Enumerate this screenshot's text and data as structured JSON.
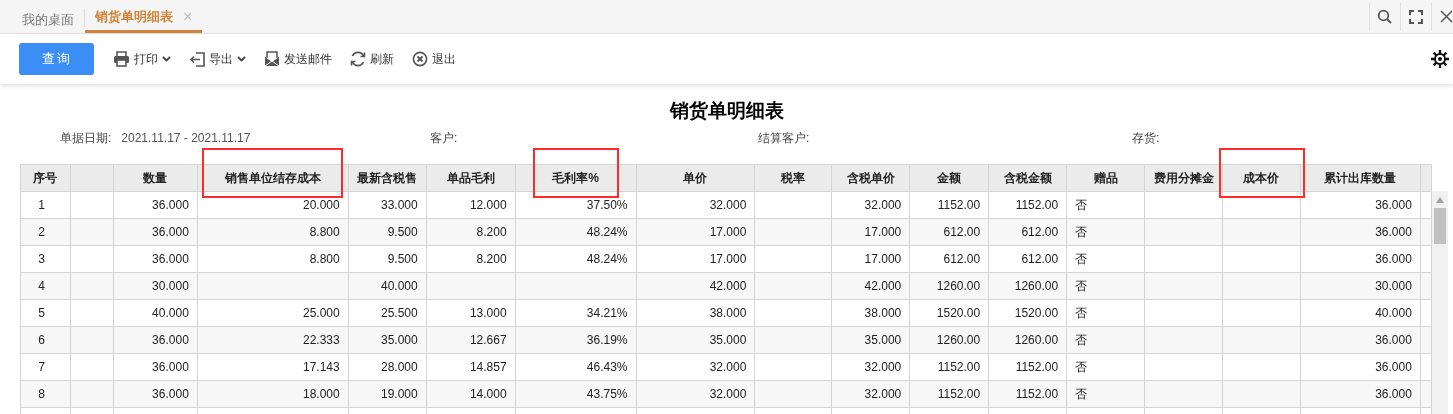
{
  "tabs": [
    {
      "label": "我的桌面",
      "selected": false
    },
    {
      "label": "销货单明细表",
      "selected": true,
      "close": "×"
    }
  ],
  "toolbar": {
    "query_button": "查询",
    "items": [
      {
        "label": "打印",
        "dropdown": true
      },
      {
        "label": "导出",
        "dropdown": true
      },
      {
        "label": "发送邮件",
        "dropdown": false
      },
      {
        "label": "刷新",
        "dropdown": false
      },
      {
        "label": "退出",
        "dropdown": false
      }
    ]
  },
  "report": {
    "title": "销货单明细表",
    "filters": [
      {
        "label": "单据日期:",
        "value": "2021.11.17 - 2021.11.17"
      },
      {
        "label": "客户:"
      },
      {
        "label": "结算客户:"
      },
      {
        "label": "存货:"
      }
    ],
    "table": {
      "columns": [
        {
          "label": "序号",
          "kind": "index",
          "highlighted": false
        },
        {
          "kind": "number",
          "highlighted": false
        },
        {
          "label": "数量",
          "kind": "number",
          "highlighted": false
        },
        {
          "label": "销售单位结存成本",
          "kind": "number",
          "highlighted": true
        },
        {
          "label": "最新含税售",
          "kind": "number",
          "highlighted": false
        },
        {
          "label": "单品毛利",
          "kind": "number",
          "highlighted": false
        },
        {
          "label": "毛利率%",
          "kind": "number",
          "highlighted": true
        },
        {
          "label": "单价",
          "kind": "number",
          "highlighted": false
        },
        {
          "label": "税率",
          "kind": "number",
          "highlighted": false
        },
        {
          "label": "含税单价",
          "kind": "number",
          "highlighted": false
        },
        {
          "label": "金额",
          "kind": "number",
          "highlighted": false
        },
        {
          "label": "含税金额",
          "kind": "number",
          "highlighted": false
        },
        {
          "label": "赠品",
          "kind": "text",
          "highlighted": false
        },
        {
          "label": "费用分摊金",
          "kind": "number",
          "highlighted": false
        },
        {
          "label": "成本价",
          "kind": "number",
          "highlighted": true
        },
        {
          "label": "累计出库数量",
          "kind": "number",
          "highlighted": false
        }
      ],
      "rows": [
        [
          "1",
          null,
          "36.000",
          "20.000",
          "33.000",
          "12.000",
          "37.50%",
          "32.000",
          null,
          "32.000",
          "1152.00",
          "1152.00",
          "否",
          null,
          null,
          "36.000"
        ],
        [
          "2",
          null,
          "36.000",
          "8.800",
          "9.500",
          "8.200",
          "48.24%",
          "17.000",
          null,
          "17.000",
          "612.00",
          "612.00",
          "否",
          null,
          null,
          "36.000"
        ],
        [
          "3",
          null,
          "36.000",
          "8.800",
          "9.500",
          "8.200",
          "48.24%",
          "17.000",
          null,
          "17.000",
          "612.00",
          "612.00",
          "否",
          null,
          null,
          "36.000"
        ],
        [
          "4",
          null,
          "30.000",
          null,
          "40.000",
          null,
          null,
          "42.000",
          null,
          "42.000",
          "1260.00",
          "1260.00",
          "否",
          null,
          null,
          "30.000"
        ],
        [
          "5",
          null,
          "40.000",
          "25.000",
          "25.500",
          "13.000",
          "34.21%",
          "38.000",
          null,
          "38.000",
          "1520.00",
          "1520.00",
          "否",
          null,
          null,
          "40.000"
        ],
        [
          "6",
          null,
          "36.000",
          "22.333",
          "35.000",
          "12.667",
          "36.19%",
          "35.000",
          null,
          "35.000",
          "1260.00",
          "1260.00",
          "否",
          null,
          null,
          "36.000"
        ],
        [
          "7",
          null,
          "36.000",
          "17.143",
          "28.000",
          "14.857",
          "46.43%",
          "32.000",
          null,
          "32.000",
          "1152.00",
          "1152.00",
          "否",
          null,
          null,
          "36.000"
        ],
        [
          "8",
          null,
          "36.000",
          "18.000",
          "19.000",
          "14.000",
          "43.75%",
          "32.000",
          null,
          "32.000",
          "1152.00",
          "1152.00",
          "否",
          null,
          null,
          "36.000"
        ]
      ]
    }
  }
}
